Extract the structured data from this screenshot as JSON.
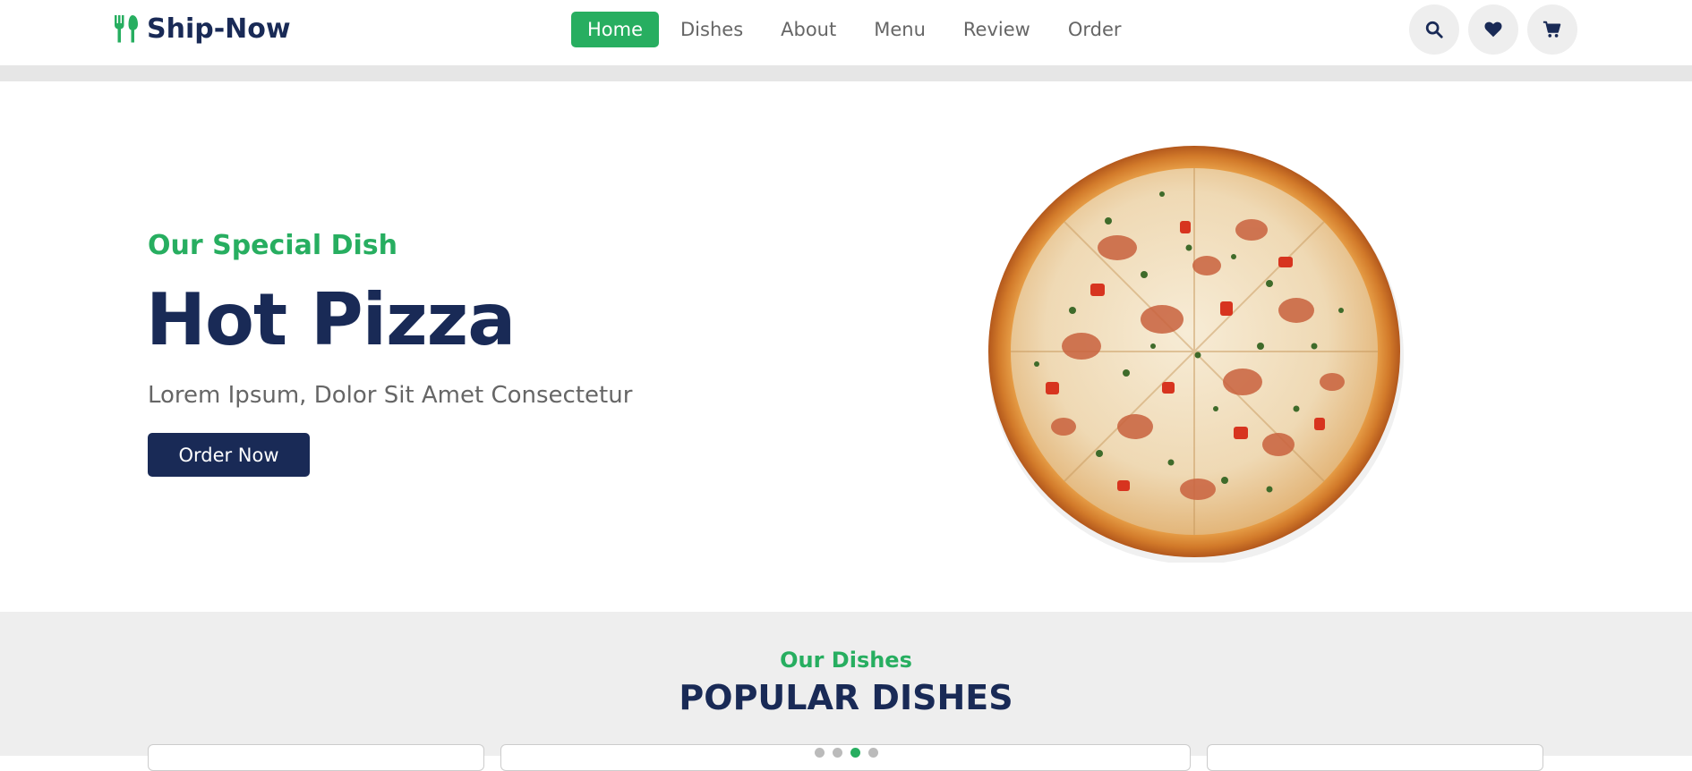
{
  "brand": {
    "name": "Ship-Now",
    "accent": "#27ae60",
    "dark": "#192a56"
  },
  "nav": {
    "items": [
      {
        "label": "Home",
        "active": true
      },
      {
        "label": "Dishes",
        "active": false
      },
      {
        "label": "About",
        "active": false
      },
      {
        "label": "Menu",
        "active": false
      },
      {
        "label": "Review",
        "active": false
      },
      {
        "label": "Order",
        "active": false
      }
    ]
  },
  "header_icons": [
    "search-icon",
    "heart-icon",
    "cart-icon"
  ],
  "hero": {
    "subtitle": "Our Special Dish",
    "title": "Hot Pizza",
    "description": "Lorem Ipsum, Dolor Sit Amet Consectetur",
    "button_label": "Order Now"
  },
  "dishes": {
    "subtitle": "Our Dishes",
    "title": "POPULAR DISHES",
    "carousel": {
      "total": 4,
      "active_index": 2
    }
  }
}
